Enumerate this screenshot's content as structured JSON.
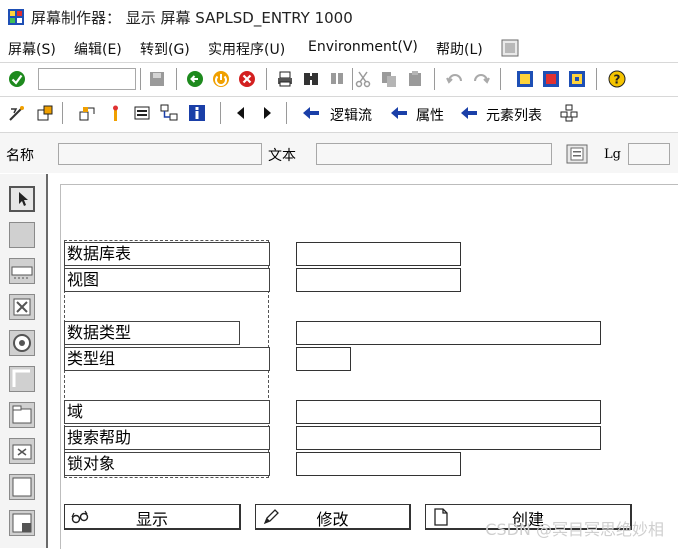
{
  "window": {
    "title": "屏幕制作器： 显示 屏幕 SAPLSD_ENTRY 1000"
  },
  "menu": {
    "items": [
      {
        "id": "screen",
        "label": "屏幕(S)"
      },
      {
        "id": "edit",
        "label": "编辑(E)"
      },
      {
        "id": "goto",
        "label": "转到(G)"
      },
      {
        "id": "utilities",
        "label": "实用程序(U)"
      },
      {
        "id": "environment",
        "label": "Environment(V)"
      },
      {
        "id": "help",
        "label": "帮助(L)"
      }
    ]
  },
  "toolbar2": {
    "logic_flow": "逻辑流",
    "attributes": "属性",
    "element_list": "元素列表"
  },
  "namebar": {
    "name_label": "名称",
    "text_label": "文本",
    "lg_label": "Lg",
    "name_value": "",
    "text_value": "",
    "lg_value": ""
  },
  "form": {
    "db_table": "数据库表",
    "view": "视图",
    "data_type": "数据类型",
    "type_group": "类型组",
    "domain": "域",
    "search_help": "搜索帮助",
    "lock_object": "锁对象"
  },
  "buttons": {
    "display": "显示",
    "change": "修改",
    "create": "创建"
  },
  "watermark": "CSDN @冥目冥思绝妙相",
  "colors": {
    "green_check": "#1e8a1e",
    "arrow_blue": "#1a3fa8",
    "help_yellow": "#f5c400"
  }
}
